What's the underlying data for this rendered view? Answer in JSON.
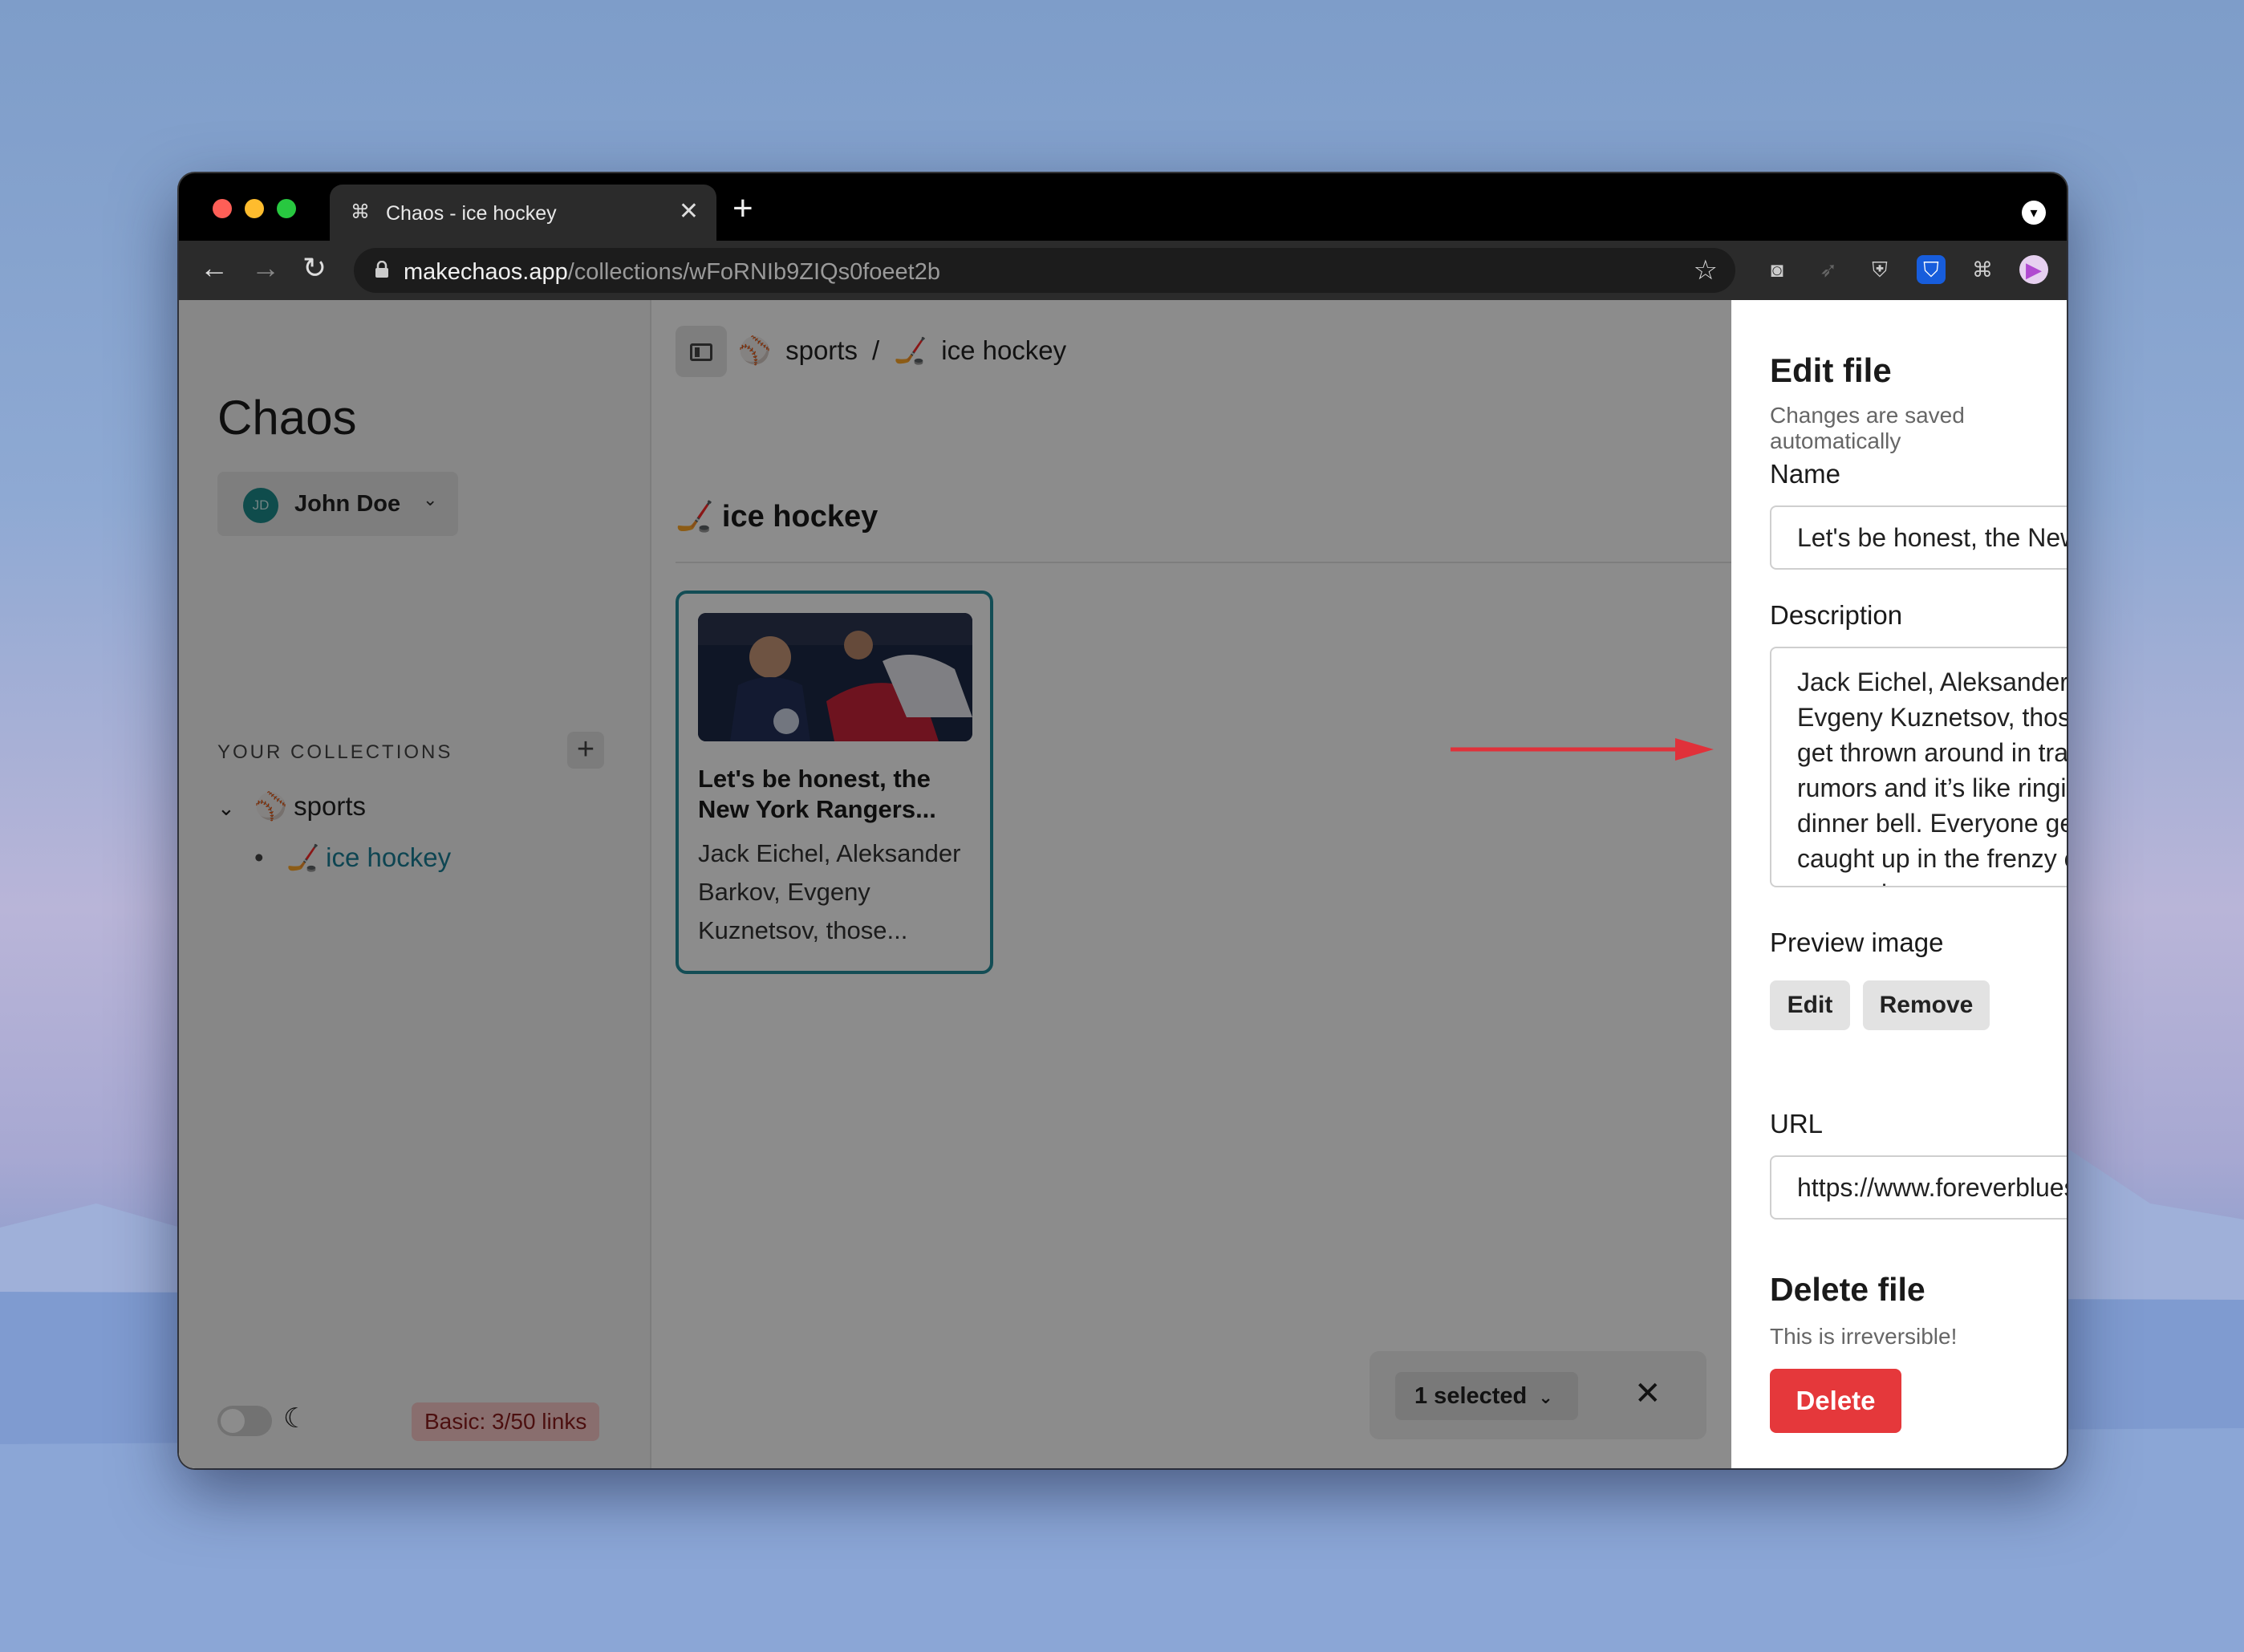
{
  "browser": {
    "tab_title": "Chaos - ice hockey",
    "url_host": "makechaos.app",
    "url_path": "/collections/wFoRNIb9ZIQs0foeet2b",
    "close_tab": "✕",
    "new_tab": "+"
  },
  "sidebar": {
    "app_title": "Chaos",
    "user": {
      "initials": "JD",
      "name": "John Doe"
    },
    "section_label": "YOUR COLLECTIONS",
    "add_label": "+",
    "collections": [
      {
        "emoji": "⚾",
        "label": "sports",
        "expanded": true
      },
      {
        "emoji": "🏒",
        "label": "ice hockey",
        "active": true
      }
    ],
    "plan_badge": "Basic: 3/50 links",
    "moon": "☾"
  },
  "main": {
    "breadcrumb": [
      {
        "emoji": "⚾",
        "label": "sports"
      },
      {
        "separator": "/"
      },
      {
        "emoji": "🏒",
        "label": "ice hockey"
      }
    ],
    "collection_heading": {
      "emoji": "🏒",
      "label": "ice hockey"
    },
    "card": {
      "title": "Let's be honest, the New York Rangers...",
      "description": "Jack Eichel, Aleksander Barkov, Evgeny Kuznetsov, those..."
    },
    "selection_bar": {
      "label": "1 selected",
      "chevron": "⌄",
      "close": "✕"
    }
  },
  "panel": {
    "close": "✕",
    "title": "Edit file",
    "subtitle": "Changes are saved automatically",
    "name_label": "Name",
    "name_value": "Let's be honest, the New York R",
    "description_label": "Description",
    "description_value": "Jack Eichel, Aleksander Barkov, Evgeny Kuznetsov, those names get thrown around in trade rumors and it’s like ringing the dinner bell. Everyone gets caught up in the frenzy of trying to acquire",
    "preview_label": "Preview image",
    "edit_button": "Edit",
    "remove_button": "Remove",
    "url_label": "URL",
    "url_value": "https://www.foreverblues",
    "delete_heading": "Delete file",
    "delete_warning": "This is irreversible!",
    "delete_button": "Delete",
    "help": "?"
  },
  "colors": {
    "accent": "#238c9c",
    "danger": "#e5383b",
    "plan_badge_bg": "#f9c9c9",
    "annotation_arrow": "#e0313a"
  }
}
